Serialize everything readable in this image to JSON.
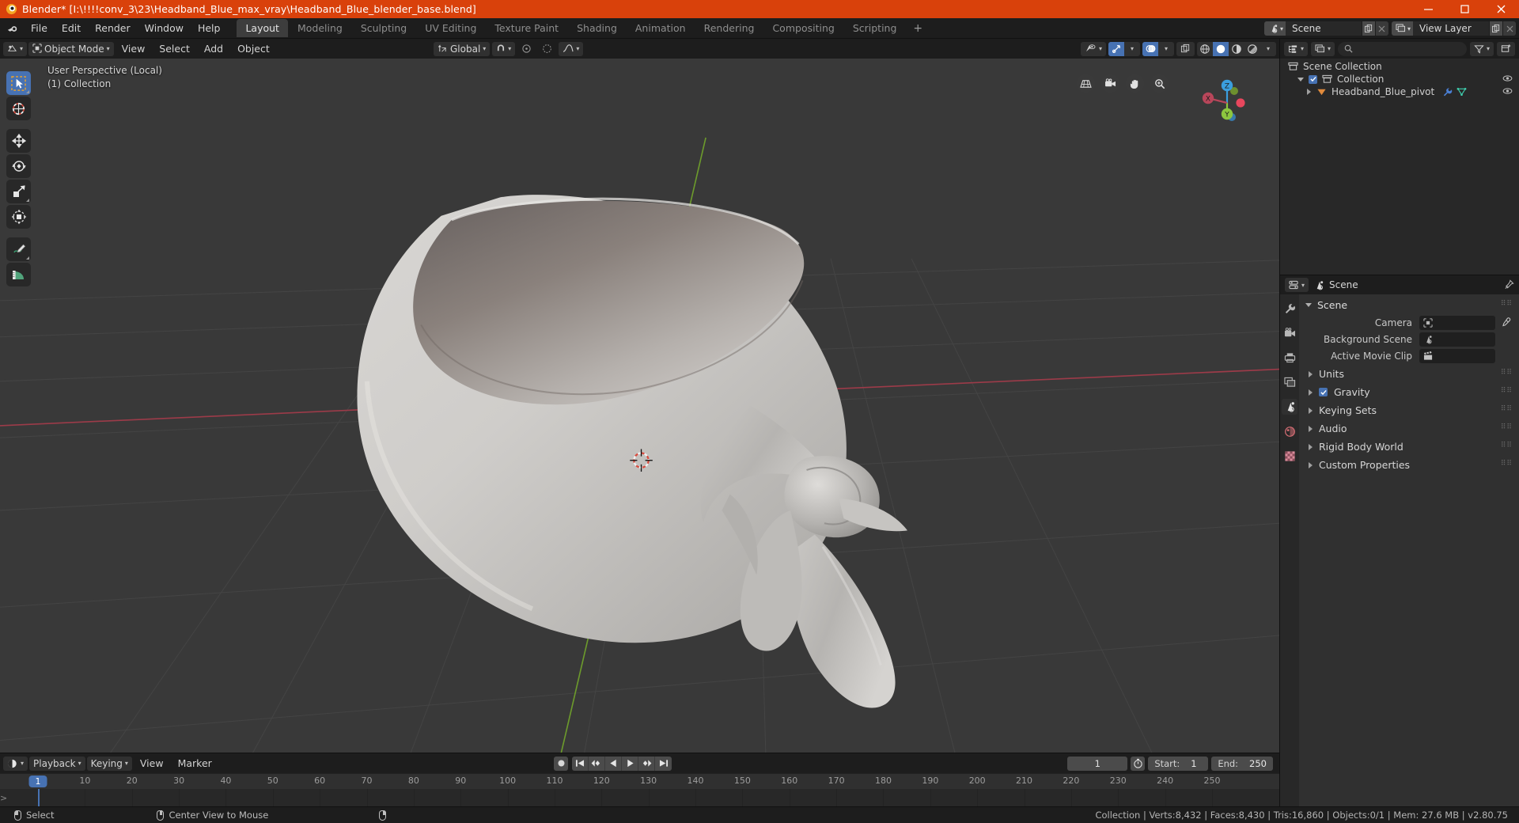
{
  "titlebar": {
    "title": "Blender* [I:\\!!!!conv_3\\23\\Headband_Blue_max_vray\\Headband_Blue_blender_base.blend]",
    "logo_icon": "blender-logo-icon",
    "minimize_icon": "minimize-icon",
    "maximize_icon": "maximize-icon",
    "close_icon": "close-icon",
    "bg_color": "#d9410b"
  },
  "topbar": {
    "app_icon": "blender-app-icon",
    "menus": [
      "File",
      "Edit",
      "Render",
      "Window",
      "Help"
    ],
    "workspaces": [
      {
        "label": "Layout",
        "active": true
      },
      {
        "label": "Modeling",
        "active": false
      },
      {
        "label": "Sculpting",
        "active": false
      },
      {
        "label": "UV Editing",
        "active": false
      },
      {
        "label": "Texture Paint",
        "active": false
      },
      {
        "label": "Shading",
        "active": false
      },
      {
        "label": "Animation",
        "active": false
      },
      {
        "label": "Rendering",
        "active": false
      },
      {
        "label": "Compositing",
        "active": false
      },
      {
        "label": "Scripting",
        "active": false
      }
    ],
    "add_workspace_label": "+",
    "scene_field": {
      "icon": "scene-icon",
      "value": "Scene",
      "copy_icon": "new-scene-icon",
      "unlink_icon": "unlink-icon"
    },
    "viewlayer_field": {
      "icon": "viewlayer-icon",
      "value": "View Layer",
      "copy_icon": "new-viewlayer-icon",
      "unlink_icon": "unlink-icon"
    }
  },
  "viewport_header": {
    "editor_type_icon": "editor-type-3dview-icon",
    "mode": "Object Mode",
    "mode_icon": "object-mode-icon",
    "menus": [
      "View",
      "Select",
      "Add",
      "Object"
    ],
    "transform_orientation": {
      "icon": "orientation-icon",
      "value": "Global"
    },
    "snap_magnet_icon": "magnet-icon",
    "snap_target_icon": "snap-target-icon",
    "proportional_icon": "proportional-edit-icon",
    "proportional_falloff_icon": "falloff-curve-icon",
    "visibility_icon": "object-visibility-icon",
    "gizmo_icon": "gizmo-icon",
    "overlays_icon": "overlays-icon",
    "xray_icon": "xray-toggle-icon",
    "shading_modes": [
      {
        "icon": "shading-wireframe-icon",
        "active": false
      },
      {
        "icon": "shading-solid-icon",
        "active": true
      },
      {
        "icon": "shading-material-icon",
        "active": false
      },
      {
        "icon": "shading-rendered-icon",
        "active": false
      }
    ]
  },
  "viewport": {
    "overlay_line1": "User Perspective (Local)",
    "overlay_line2": "(1) Collection",
    "tools": [
      {
        "name": "tweak-select-tool",
        "icon": "cursor-arrow-icon",
        "active": true
      },
      {
        "name": "cursor-tool",
        "icon": "3d-cursor-icon",
        "active": false
      },
      {
        "name": "move-tool",
        "icon": "move-arrows-icon",
        "active": false
      },
      {
        "name": "rotate-tool",
        "icon": "rotate-icon",
        "active": false
      },
      {
        "name": "scale-tool",
        "icon": "scale-icon",
        "active": false
      },
      {
        "name": "transform-tool",
        "icon": "transform-icon",
        "active": false
      },
      {
        "name": "annotate-tool",
        "icon": "pencil-icon",
        "active": false
      },
      {
        "name": "measure-tool",
        "icon": "ruler-icon",
        "active": false
      }
    ],
    "nav_icons": [
      "grid-view-icon",
      "camera-view-icon",
      "hand-pan-icon",
      "zoom-magnifier-icon"
    ],
    "gizmo_axes": [
      {
        "label": "X",
        "color": "#b8465a"
      },
      {
        "label": "Y",
        "color": "#8dc63f"
      },
      {
        "label": "Z",
        "color": "#3b9ede"
      }
    ],
    "background_color": "#393939",
    "grid_color": "#4b4b4b",
    "x_axis_color": "#a33f4e",
    "y_axis_color": "#6e9e2e"
  },
  "timeline": {
    "editor_icon": "timeline-editor-icon",
    "menus": [
      "Playback",
      "Keying",
      "View",
      "Marker"
    ],
    "playback_dropdown": true,
    "keying_dropdown": true,
    "record_icon": "record-icon",
    "controls": [
      {
        "name": "jump-to-start-button",
        "icon": "jump-start-icon"
      },
      {
        "name": "previous-keyframe-button",
        "icon": "prev-keyframe-icon"
      },
      {
        "name": "play-reverse-button",
        "icon": "play-reverse-icon"
      },
      {
        "name": "play-button",
        "icon": "play-icon"
      },
      {
        "name": "next-keyframe-button",
        "icon": "next-keyframe-icon"
      },
      {
        "name": "jump-to-end-button",
        "icon": "jump-end-icon"
      }
    ],
    "current_frame": "1",
    "autokey_icon": "stopwatch-icon",
    "start_label": "Start:",
    "start_value": "1",
    "end_label": "End:",
    "end_value": "250",
    "ticks": [
      "1",
      "10",
      "20",
      "30",
      "40",
      "50",
      "60",
      "70",
      "80",
      "90",
      "100",
      "110",
      "120",
      "130",
      "140",
      "150",
      "160",
      "170",
      "180",
      "190",
      "200",
      "210",
      "220",
      "230",
      "240",
      "250"
    ],
    "playhead_frame": "1"
  },
  "outliner": {
    "display_mode_icon": "outliner-display-mode-icon",
    "filter_view_icon": "viewlayer-display-icon",
    "search_icon": "search-icon",
    "search_placeholder": "",
    "filter_icon": "filter-funnel-icon",
    "new_collection_icon": "new-collection-icon",
    "rows": [
      {
        "label": "Scene Collection",
        "icon": "collection-icon",
        "indent": 0,
        "disclosure": "none",
        "checkbox": false,
        "eye": false,
        "extra_icons": []
      },
      {
        "label": "Collection",
        "icon": "collection-icon",
        "indent": 1,
        "disclosure": "open",
        "checkbox": true,
        "eye": true,
        "extra_icons": []
      },
      {
        "label": "Headband_Blue_pivot",
        "icon": "mesh-object-icon",
        "indent": 2,
        "disclosure": "closed",
        "checkbox": false,
        "eye": true,
        "extra_icons": [
          "modifier-wrench-icon",
          "mesh-data-icon"
        ]
      }
    ]
  },
  "properties": {
    "editor_icon": "properties-editor-icon",
    "breadcrumb_icon": "scene-props-icon",
    "breadcrumb": "Scene",
    "pin_icon": "pin-icon",
    "tabs": [
      {
        "name": "tool-tab",
        "icon": "tool-wrench-icon",
        "active": false
      },
      {
        "name": "render-tab",
        "icon": "render-camera-icon",
        "active": false
      },
      {
        "name": "output-tab",
        "icon": "output-printer-icon",
        "active": false
      },
      {
        "name": "viewlayer-tab",
        "icon": "viewlayer-images-icon",
        "active": false
      },
      {
        "name": "scene-tab",
        "icon": "scene-cone-icon",
        "active": true
      },
      {
        "name": "world-tab",
        "icon": "world-globe-icon",
        "active": false
      },
      {
        "name": "texture-tab",
        "icon": "texture-checker-icon",
        "active": false
      }
    ],
    "panel_title": "Scene",
    "fields": [
      {
        "label": "Camera",
        "value": "",
        "icon": "camera-data-icon",
        "eyedropper": true
      },
      {
        "label": "Background Scene",
        "value": "",
        "icon": "scene-data-icon",
        "eyedropper": false
      },
      {
        "label": "Active Movie Clip",
        "value": "",
        "icon": "movieclip-data-icon",
        "eyedropper": false
      }
    ],
    "subpanels": [
      {
        "label": "Units",
        "checkbox": false,
        "checked": false
      },
      {
        "label": "Gravity",
        "checkbox": true,
        "checked": true
      },
      {
        "label": "Keying Sets",
        "checkbox": false,
        "checked": false
      },
      {
        "label": "Audio",
        "checkbox": false,
        "checked": false
      },
      {
        "label": "Rigid Body World",
        "checkbox": false,
        "checked": false
      },
      {
        "label": "Custom Properties",
        "checkbox": false,
        "checked": false
      }
    ]
  },
  "statusbar": {
    "left_mouse_icon": "mouse-left-icon",
    "left_action": "Select",
    "middle_mouse_icon": "mouse-middle-icon",
    "middle_action": "Center View to Mouse",
    "right_mouse_icon": "mouse-right-icon",
    "stats": "Collection | Verts:8,432 | Faces:8,430 | Tris:16,860 | Objects:0/1 | Mem: 27.6 MB | v2.80.75"
  }
}
